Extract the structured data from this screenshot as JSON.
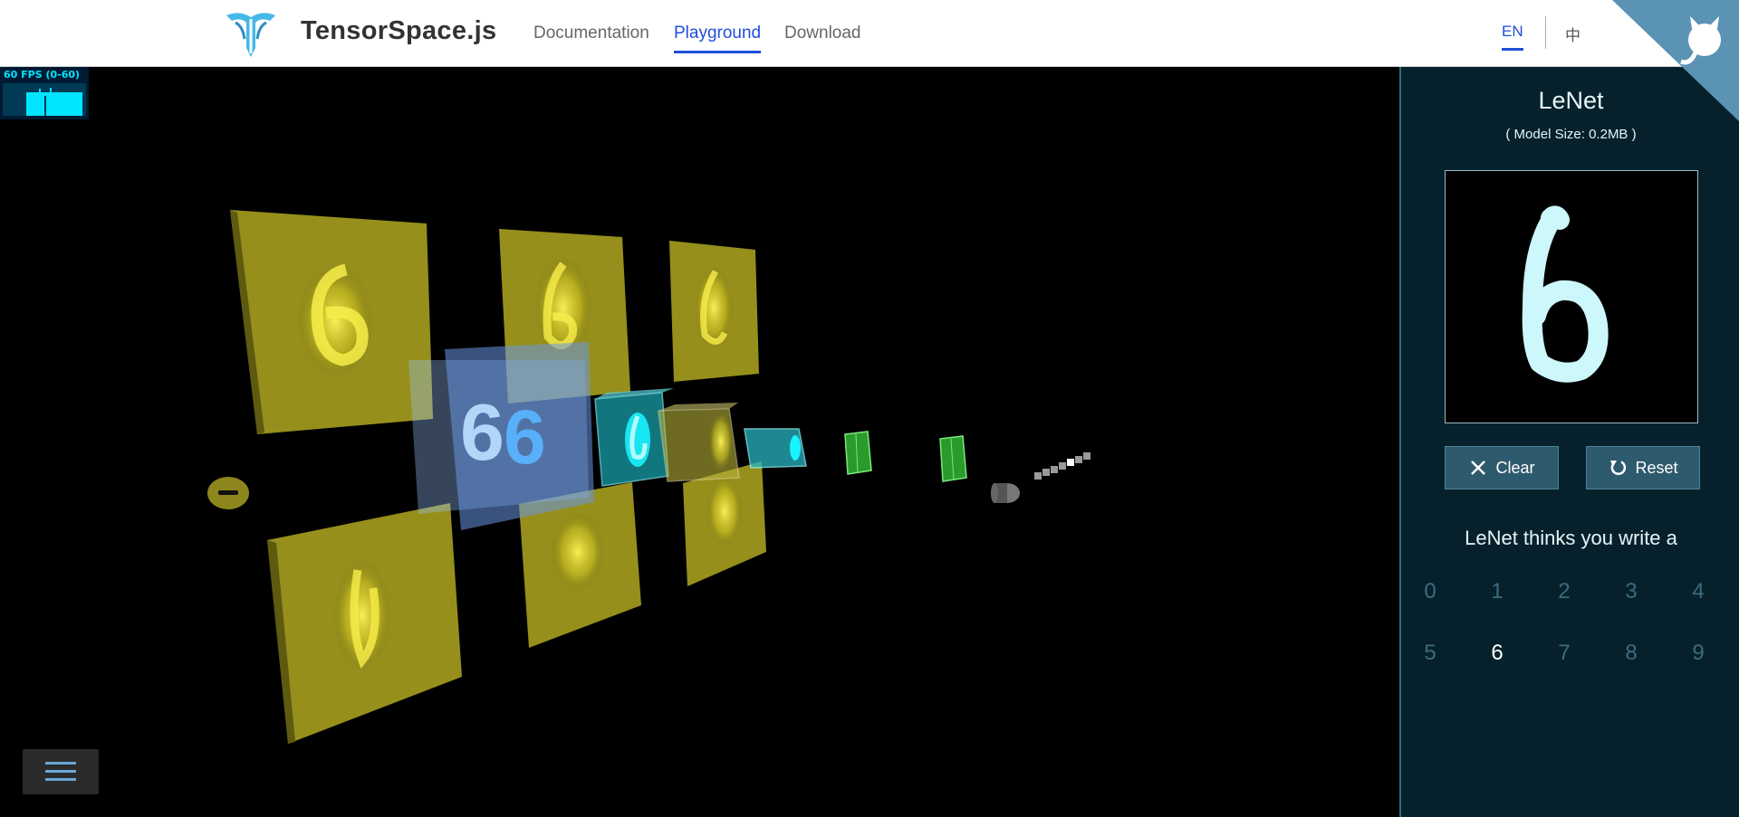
{
  "header": {
    "brand": "TensorSpace.js",
    "nav": [
      {
        "label": "Documentation",
        "active": false
      },
      {
        "label": "Playground",
        "active": true
      },
      {
        "label": "Download",
        "active": false
      }
    ],
    "languages": [
      {
        "label": "EN",
        "active": true
      },
      {
        "label": "中",
        "active": false
      }
    ],
    "corner_icon": "github-octocat-icon",
    "accent_color": "#1f4fd8"
  },
  "fps_meter": {
    "label": "60 FPS (0-60)",
    "color": "#00e5ff"
  },
  "viewport": {
    "menu_icon": "hamburger-menu-icon"
  },
  "panel": {
    "model_name": "LeNet",
    "model_size": "( Model Size: 0.2MB )",
    "drawn_digit": "6",
    "buttons": {
      "clear": {
        "label": "Clear",
        "icon": "close-icon"
      },
      "reset": {
        "label": "Reset",
        "icon": "refresh-icon"
      }
    },
    "prediction_label": "LeNet thinks you write a",
    "digits": [
      "0",
      "1",
      "2",
      "3",
      "4",
      "5",
      "6",
      "7",
      "8",
      "9"
    ],
    "predicted": "6"
  }
}
